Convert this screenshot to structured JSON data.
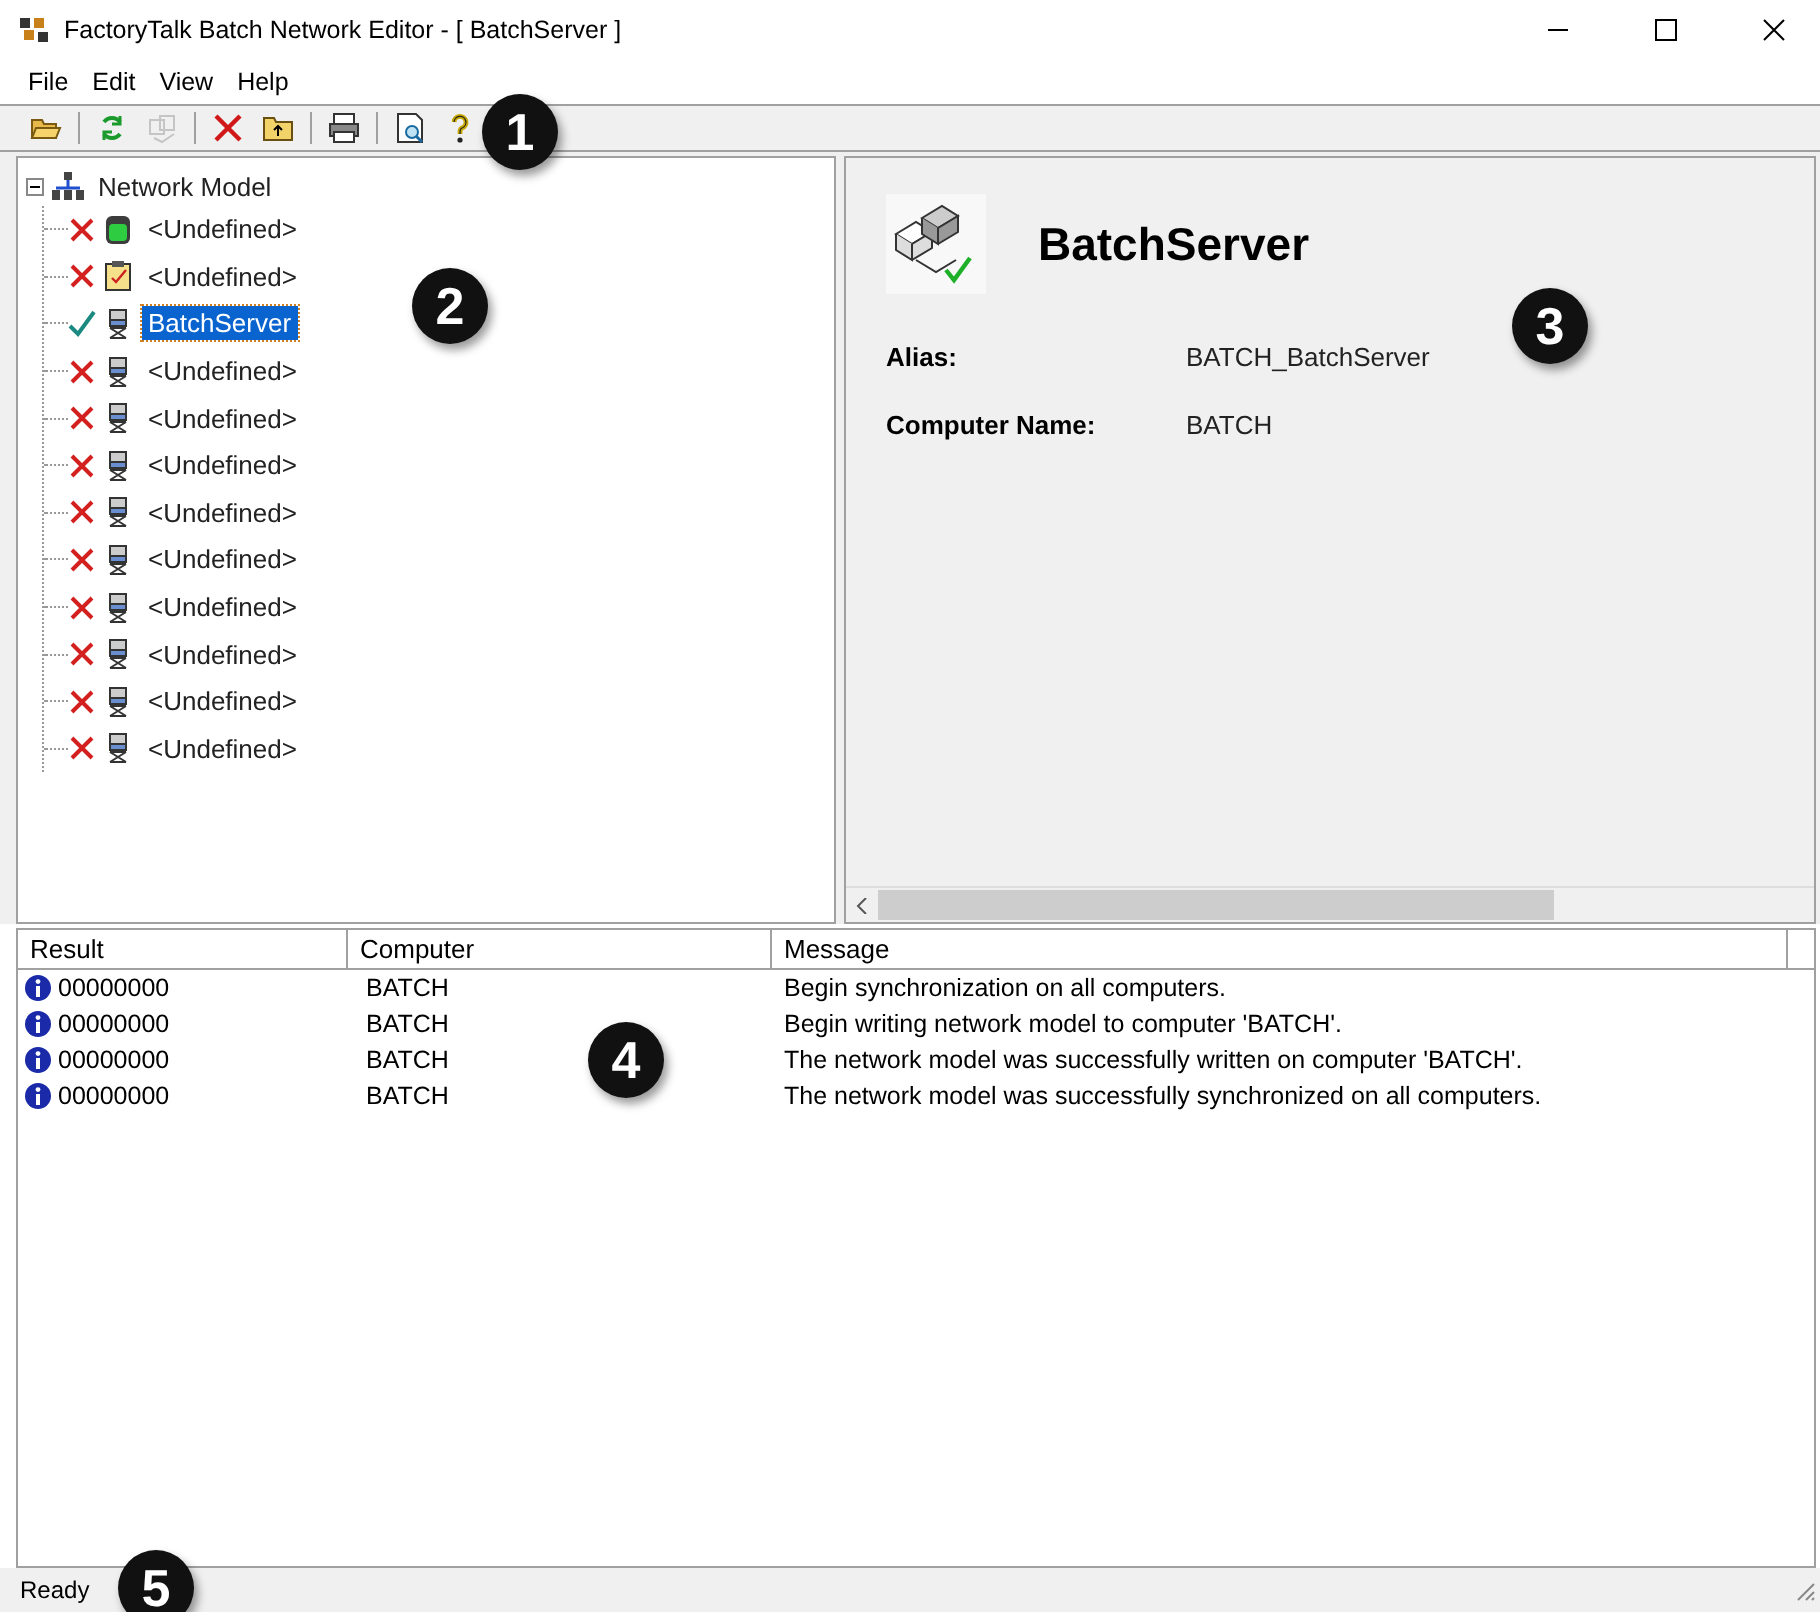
{
  "window": {
    "title": "FactoryTalk Batch Network Editor - [ BatchServer ]"
  },
  "menu": [
    {
      "label": "File"
    },
    {
      "label": "Edit"
    },
    {
      "label": "View"
    },
    {
      "label": "Help"
    }
  ],
  "toolbar": [
    {
      "kind": "open",
      "disabled": false
    },
    {
      "kind": "refresh",
      "disabled": false
    },
    {
      "kind": "network",
      "disabled": true
    },
    {
      "kind": "delete",
      "disabled": false
    },
    {
      "kind": "folder-up",
      "disabled": false
    },
    {
      "kind": "print",
      "disabled": false
    },
    {
      "kind": "preview",
      "disabled": false
    },
    {
      "kind": "help",
      "disabled": false
    }
  ],
  "tree": {
    "label": "Network Model",
    "expanded": true,
    "children": [
      {
        "label": "<Undefined>",
        "kind": "database",
        "valid": false,
        "selected": false
      },
      {
        "label": "<Undefined>",
        "kind": "clipboard",
        "valid": false,
        "selected": false
      },
      {
        "label": "BatchServer",
        "kind": "server",
        "valid": true,
        "selected": true
      },
      {
        "label": "<Undefined>",
        "kind": "server",
        "valid": false,
        "selected": false
      },
      {
        "label": "<Undefined>",
        "kind": "server",
        "valid": false,
        "selected": false
      },
      {
        "label": "<Undefined>",
        "kind": "server",
        "valid": false,
        "selected": false
      },
      {
        "label": "<Undefined>",
        "kind": "server",
        "valid": false,
        "selected": false
      },
      {
        "label": "<Undefined>",
        "kind": "server",
        "valid": false,
        "selected": false
      },
      {
        "label": "<Undefined>",
        "kind": "server",
        "valid": false,
        "selected": false
      },
      {
        "label": "<Undefined>",
        "kind": "server",
        "valid": false,
        "selected": false
      },
      {
        "label": "<Undefined>",
        "kind": "server",
        "valid": false,
        "selected": false
      },
      {
        "label": "<Undefined>",
        "kind": "server",
        "valid": false,
        "selected": false
      }
    ]
  },
  "details": {
    "title": "BatchServer",
    "fields": [
      {
        "label": "Alias:",
        "value": "BATCH_BatchServer"
      },
      {
        "label": "Computer Name:",
        "value": "BATCH"
      }
    ]
  },
  "log": {
    "columns": [
      "Result",
      "Computer",
      "Message"
    ],
    "rows": [
      {
        "result": "00000000",
        "computer": "BATCH",
        "message": "Begin synchronization on all computers."
      },
      {
        "result": "00000000",
        "computer": "BATCH",
        "message": "Begin writing network model to computer 'BATCH'."
      },
      {
        "result": "00000000",
        "computer": "BATCH",
        "message": "The network model was successfully written on computer 'BATCH'."
      },
      {
        "result": "00000000",
        "computer": "BATCH",
        "message": "The network model was successfully synchronized on all computers."
      }
    ]
  },
  "status_bar": {
    "text": "Ready"
  },
  "callouts": [
    "1",
    "2",
    "3",
    "4",
    "5"
  ]
}
